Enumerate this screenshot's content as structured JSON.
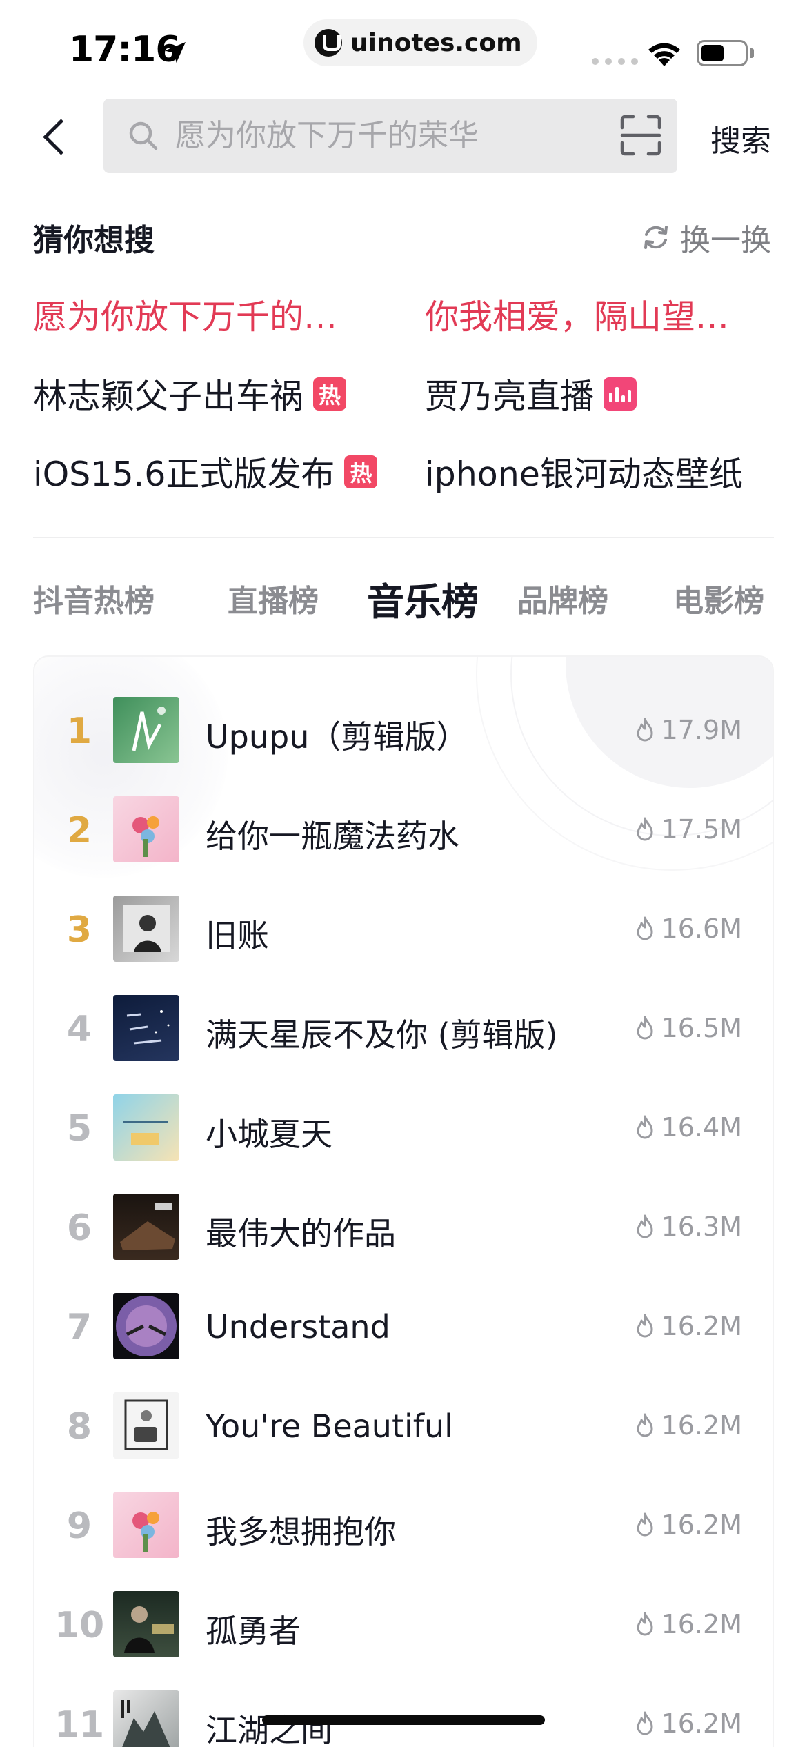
{
  "status_bar": {
    "time": "17:16",
    "url": "uinotes.com"
  },
  "search": {
    "placeholder": "愿为你放下万千的荣华",
    "action_label": "搜索"
  },
  "guess": {
    "title": "猜你想搜",
    "refresh_label": "换一换",
    "items": [
      {
        "text": "愿为你放下万千的…",
        "highlight": true
      },
      {
        "text": "你我相爱，隔山望…",
        "highlight": true
      },
      {
        "text": "林志颖父子出车祸",
        "badge": "热"
      },
      {
        "text": "贾乃亮直播",
        "badge_icon": "live-icon"
      },
      {
        "text": "iOS15.6正式版发布",
        "badge": "热"
      },
      {
        "text": "iphone银河动态壁纸"
      }
    ]
  },
  "tabs": [
    {
      "label": "抖音热榜"
    },
    {
      "label": "直播榜"
    },
    {
      "label": "音乐榜",
      "active": true
    },
    {
      "label": "品牌榜"
    },
    {
      "label": "电影榜"
    }
  ],
  "music_chart": [
    {
      "rank": "1",
      "title": "Upupu（剪辑版）",
      "heat": "17.9M"
    },
    {
      "rank": "2",
      "title": "给你一瓶魔法药水",
      "heat": "17.5M"
    },
    {
      "rank": "3",
      "title": "旧账",
      "heat": "16.6M"
    },
    {
      "rank": "4",
      "title": "满天星辰不及你 (剪辑版)",
      "heat": "16.5M"
    },
    {
      "rank": "5",
      "title": "小城夏天",
      "heat": "16.4M"
    },
    {
      "rank": "6",
      "title": "最伟大的作品",
      "heat": "16.3M"
    },
    {
      "rank": "7",
      "title": "Understand",
      "heat": "16.2M"
    },
    {
      "rank": "8",
      "title": "You're Beautiful",
      "heat": "16.2M"
    },
    {
      "rank": "9",
      "title": "我多想拥抱你",
      "heat": "16.2M"
    },
    {
      "rank": "10",
      "title": "孤勇者",
      "heat": "16.2M"
    },
    {
      "rank": "11",
      "title": "江湖之间",
      "heat": "16.2M"
    }
  ],
  "colors": {
    "highlight": "#e23a55",
    "gold_rank": "#e0a942",
    "gray_rank": "#b9babe",
    "hot_badge": "#f24865"
  }
}
